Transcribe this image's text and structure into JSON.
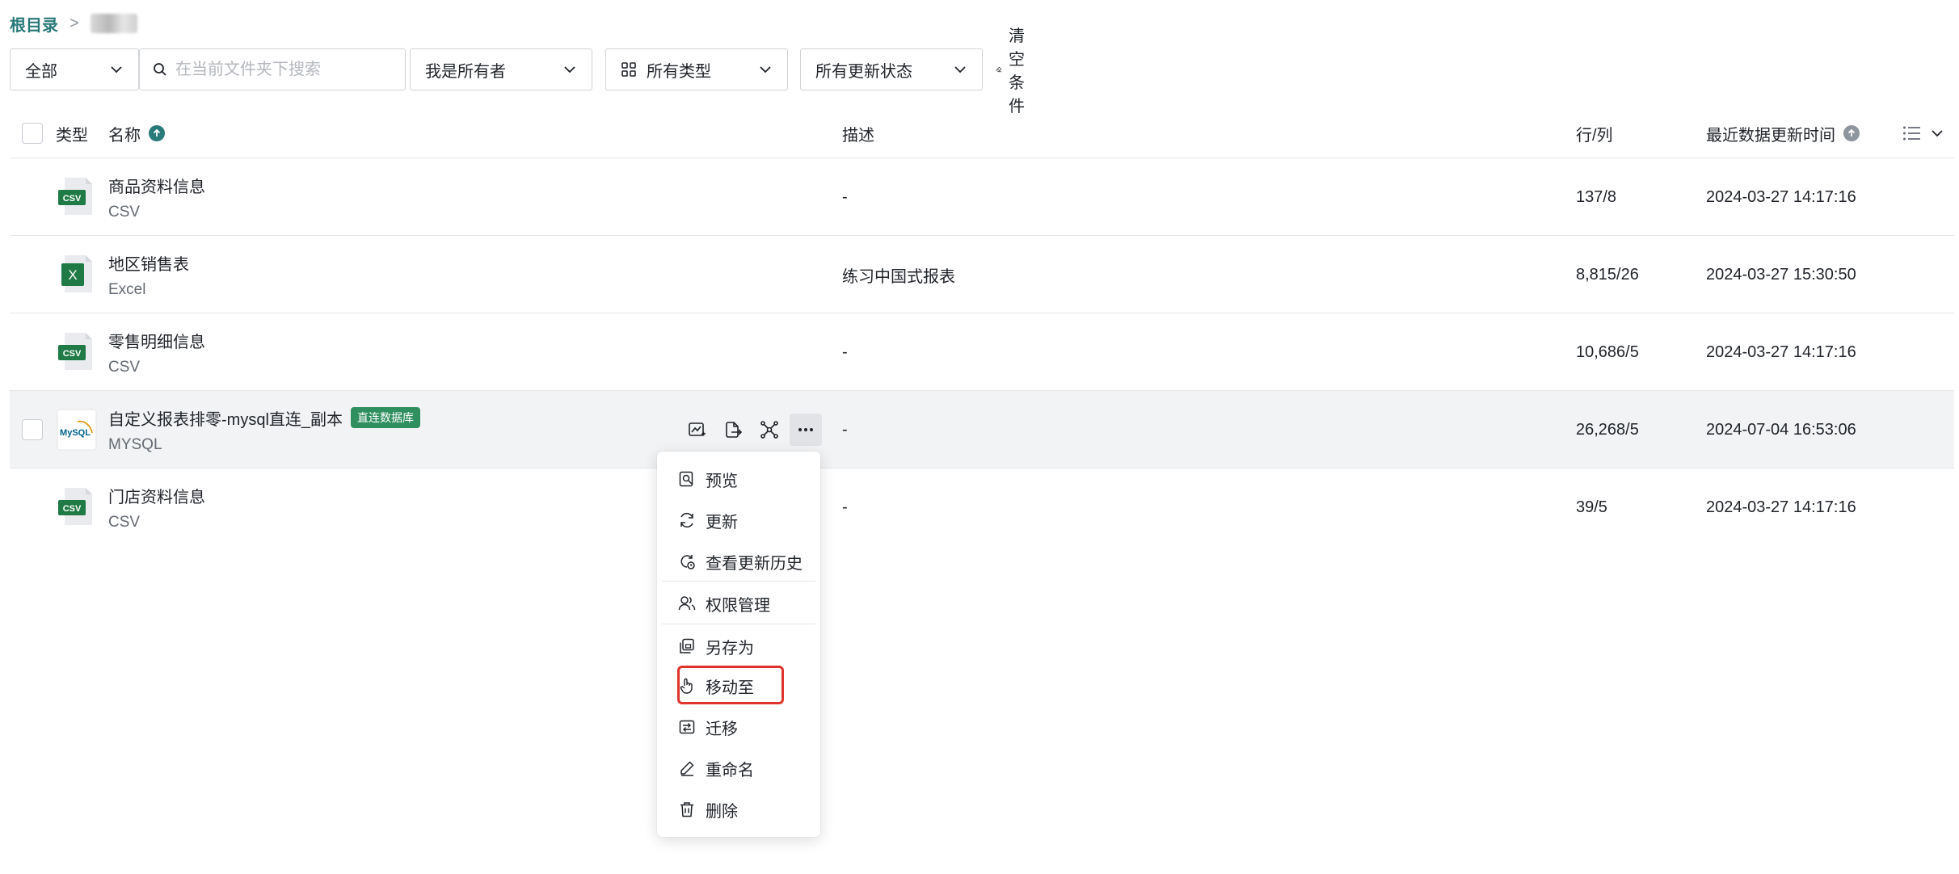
{
  "breadcrumb": {
    "root": "根目录",
    "separator": ">",
    "current": ""
  },
  "filters": {
    "scope": "全部",
    "search_placeholder": "在当前文件夹下搜索",
    "owner": "我是所有者",
    "type": "所有类型",
    "update_status": "所有更新状态",
    "clear": "清空条件"
  },
  "columns": {
    "type": "类型",
    "name": "名称",
    "description": "描述",
    "rows_cols": "行/列",
    "last_updated": "最近数据更新时间"
  },
  "rows": [
    {
      "name": "商品资料信息",
      "type": "CSV",
      "icon": "csv-file-icon",
      "desc": "-",
      "rc": "137/8",
      "time": "2024-03-27 14:17:16"
    },
    {
      "name": "地区销售表",
      "type": "Excel",
      "icon": "excel-file-icon",
      "desc": "练习中国式报表",
      "rc": "8,815/26",
      "time": "2024-03-27 15:30:50"
    },
    {
      "name": "零售明细信息",
      "type": "CSV",
      "icon": "csv-file-icon",
      "desc": "-",
      "rc": "10,686/5",
      "time": "2024-03-27 14:17:16"
    },
    {
      "name": "自定义报表排零-mysql直连_副本",
      "type": "MYSQL",
      "icon": "mysql-icon",
      "tag": "直连数据库",
      "desc": "-",
      "rc": "26,268/5",
      "time": "2024-07-04 16:53:06"
    },
    {
      "name": "门店资料信息",
      "type": "CSV",
      "icon": "csv-file-icon",
      "desc": "-",
      "rc": "39/5",
      "time": "2024-03-27 14:17:16"
    }
  ],
  "icon_labels": {
    "csv": "CSV",
    "excel": "X",
    "mysql": "MySQL"
  },
  "menu": {
    "preview": "预览",
    "update": "更新",
    "history": "查看更新历史",
    "permissions": "权限管理",
    "save_as": "另存为",
    "move_to": "移动至",
    "migrate": "迁移",
    "rename": "重命名",
    "delete": "删除"
  },
  "colors": {
    "accent": "#2a7a7a",
    "csv_green": "#1f7a45",
    "highlight": "#e0332b",
    "tag_green": "#2f8f5f"
  }
}
